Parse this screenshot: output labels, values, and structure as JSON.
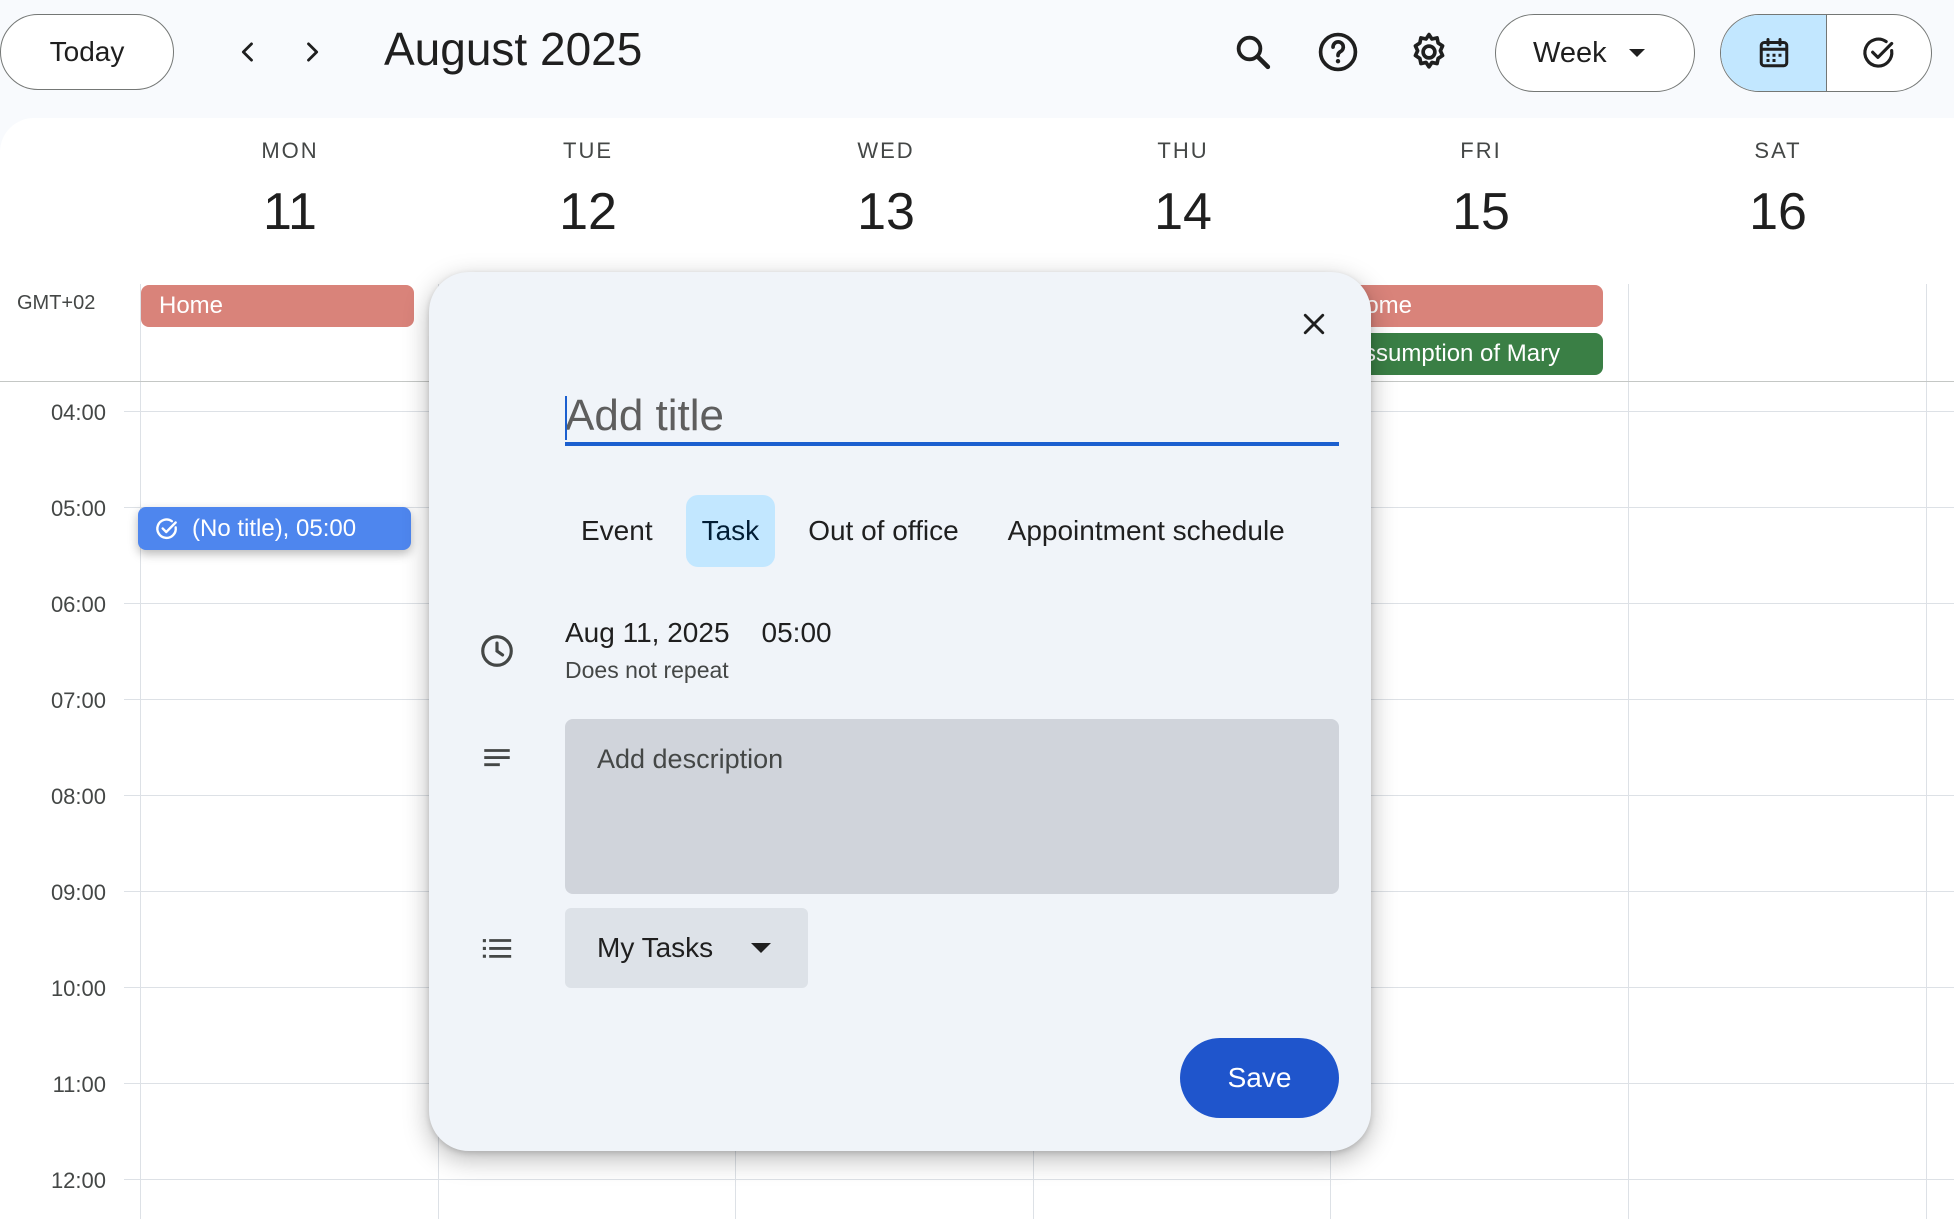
{
  "header": {
    "today_label": "Today",
    "month_title": "August 2025",
    "view_label": "Week"
  },
  "calendar": {
    "timezone": "GMT+02",
    "days": [
      {
        "dow": "MON",
        "num": "11"
      },
      {
        "dow": "TUE",
        "num": "12"
      },
      {
        "dow": "WED",
        "num": "13"
      },
      {
        "dow": "THU",
        "num": "14"
      },
      {
        "dow": "FRI",
        "num": "15"
      },
      {
        "dow": "SAT",
        "num": "16"
      }
    ],
    "hours": [
      "04:00",
      "05:00",
      "06:00",
      "07:00",
      "08:00",
      "09:00",
      "10:00",
      "11:00",
      "12:00"
    ],
    "allday_events": {
      "mon_home": "Home",
      "fri_home": "Home",
      "fri_holiday": "Assumption of Mary"
    },
    "task_chip": "(No title), 05:00",
    "colors": {
      "home": "#d9837a",
      "holiday": "#3a7f45",
      "task": "#4e86ee"
    }
  },
  "dialog": {
    "title_placeholder": "Add title",
    "tabs": [
      "Event",
      "Task",
      "Out of office",
      "Appointment schedule"
    ],
    "active_tab": "Task",
    "date": "Aug 11, 2025",
    "time": "05:00",
    "repeat": "Does not repeat",
    "description_placeholder": "Add description",
    "task_list": "My Tasks",
    "save_label": "Save"
  }
}
